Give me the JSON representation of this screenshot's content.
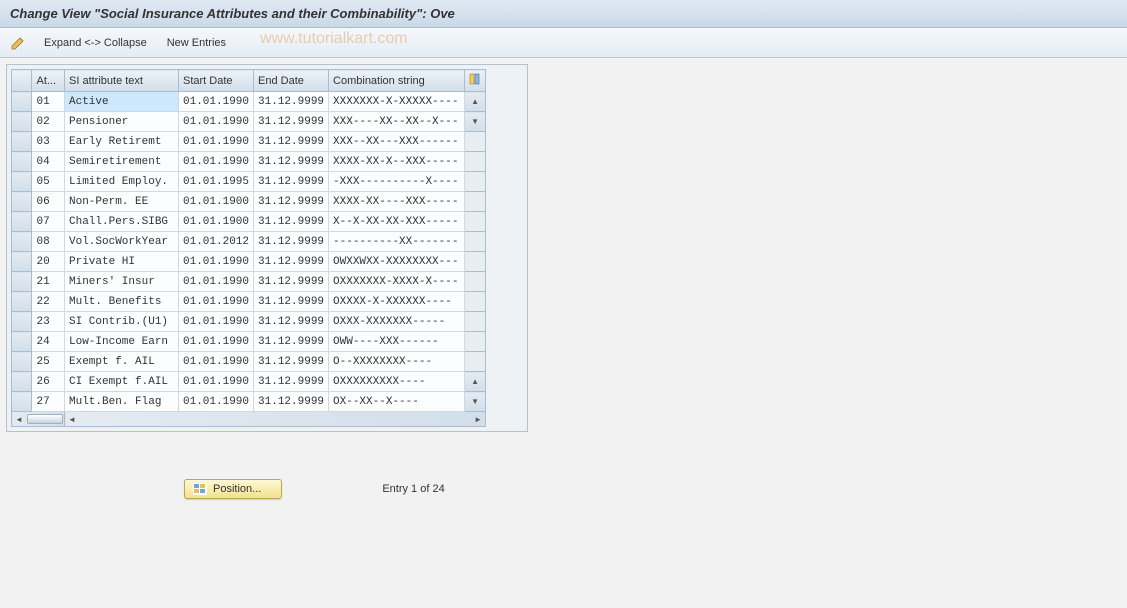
{
  "title": "Change View \"Social Insurance Attributes and their Combinability\": Ove",
  "toolbar": {
    "expand_collapse": "Expand <-> Collapse",
    "new_entries": "New Entries"
  },
  "watermark": "www.tutorialkart.com",
  "columns": {
    "handle": "",
    "at": "At...",
    "text": "SI attribute text",
    "start": "Start Date",
    "end": "End Date",
    "combo": "Combination string"
  },
  "rows": [
    {
      "at": "01",
      "text": "Active",
      "start": "01.01.1990",
      "end": "31.12.9999",
      "combo": "XXXXXXX-X-XXXXX----",
      "selected": true
    },
    {
      "at": "02",
      "text": "Pensioner",
      "start": "01.01.1990",
      "end": "31.12.9999",
      "combo": "XXX----XX--XX--X---"
    },
    {
      "at": "03",
      "text": "Early Retiremt",
      "start": "01.01.1990",
      "end": "31.12.9999",
      "combo": "XXX--XX---XXX------"
    },
    {
      "at": "04",
      "text": "Semiretirement",
      "start": "01.01.1990",
      "end": "31.12.9999",
      "combo": "XXXX-XX-X--XXX-----"
    },
    {
      "at": "05",
      "text": "Limited Employ.",
      "start": "01.01.1995",
      "end": "31.12.9999",
      "combo": "-XXX----------X----"
    },
    {
      "at": "06",
      "text": "Non-Perm. EE",
      "start": "01.01.1900",
      "end": "31.12.9999",
      "combo": "XXXX-XX----XXX-----"
    },
    {
      "at": "07",
      "text": "Chall.Pers.SIBG",
      "start": "01.01.1900",
      "end": "31.12.9999",
      "combo": "X--X-XX-XX-XXX-----"
    },
    {
      "at": "08",
      "text": "Vol.SocWorkYear",
      "start": "01.01.2012",
      "end": "31.12.9999",
      "combo": "----------XX-------"
    },
    {
      "at": "20",
      "text": "Private HI",
      "start": "01.01.1990",
      "end": "31.12.9999",
      "combo": "OWXXWXX-XXXXXXXX---"
    },
    {
      "at": "21",
      "text": "Miners' Insur",
      "start": "01.01.1990",
      "end": "31.12.9999",
      "combo": "OXXXXXXX-XXXX-X----"
    },
    {
      "at": "22",
      "text": "Mult. Benefits",
      "start": "01.01.1990",
      "end": "31.12.9999",
      "combo": " OXXXX-X-XXXXXX----"
    },
    {
      "at": "23",
      "text": "SI Contrib.(U1)",
      "start": "01.01.1990",
      "end": "31.12.9999",
      "combo": "  OXXX-XXXXXXX-----"
    },
    {
      "at": "24",
      "text": "Low-Income Earn",
      "start": "01.01.1990",
      "end": "31.12.9999",
      "combo": "   OWW----XXX------"
    },
    {
      "at": "25",
      "text": "Exempt f. AIL",
      "start": "01.01.1990",
      "end": "31.12.9999",
      "combo": "    O--XXXXXXXX----"
    },
    {
      "at": "26",
      "text": "CI Exempt f.AIL",
      "start": "01.01.1990",
      "end": "31.12.9999",
      "combo": "     OXXXXXXXXX----"
    },
    {
      "at": "27",
      "text": "Mult.Ben. Flag",
      "start": "01.01.1990",
      "end": "31.12.9999",
      "combo": "      OX--XX--X----"
    }
  ],
  "footer": {
    "position_btn": "Position...",
    "entry_text": "Entry 1 of 24"
  }
}
